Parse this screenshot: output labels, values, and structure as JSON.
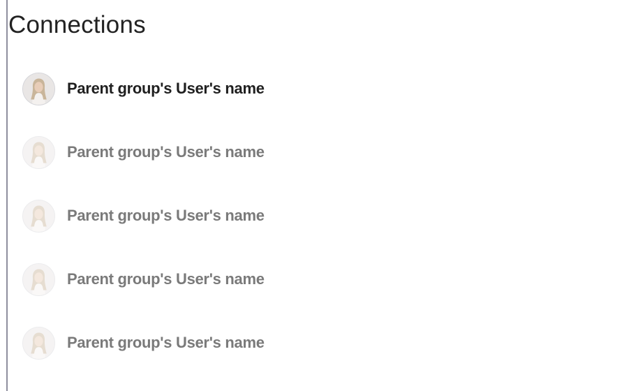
{
  "page": {
    "title": "Connections"
  },
  "connections": [
    {
      "name": "Parent group's User's name",
      "avatar": "user-avatar-icon",
      "active": true
    },
    {
      "name": "Parent group's User's name",
      "avatar": "user-avatar-icon",
      "active": false
    },
    {
      "name": "Parent group's User's name",
      "avatar": "user-avatar-icon",
      "active": false
    },
    {
      "name": "Parent group's User's name",
      "avatar": "user-avatar-icon",
      "active": false
    },
    {
      "name": "Parent group's User's name",
      "avatar": "user-avatar-icon",
      "active": false
    }
  ],
  "colors": {
    "title": "#222222",
    "active_name": "#1f1f1f",
    "inactive_name": "#7a7a7a",
    "rule": "#8e8e9e"
  }
}
